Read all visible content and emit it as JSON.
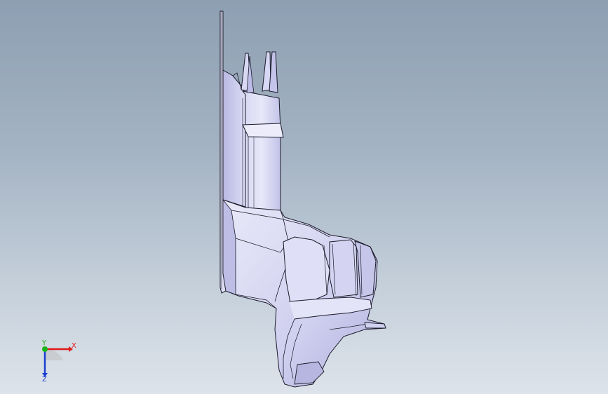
{
  "viewport": {
    "background_top": "#8d9fb2",
    "background_bottom": "#dde3ea"
  },
  "model": {
    "fill_light": "#e6e6f7",
    "fill_mid": "#c9c9ec",
    "fill_dark": "#a9a9d9",
    "edge_color": "#1a1a2a"
  },
  "triad": {
    "x_label": "X",
    "y_label": "Y",
    "z_label": "Z",
    "x_color": "#e01b1b",
    "y_color": "#1bb31b",
    "z_color": "#1b3fd1"
  }
}
